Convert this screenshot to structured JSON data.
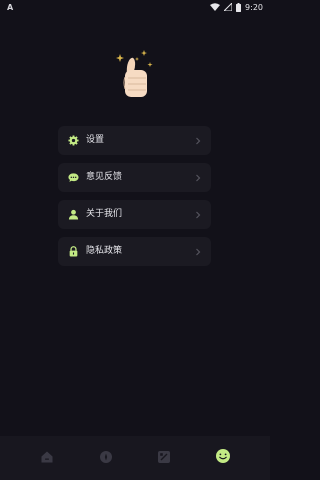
{
  "status_bar": {
    "left_label": "A",
    "time": "9:20"
  },
  "menu": {
    "items": [
      {
        "label": "设置",
        "icon": "gear-icon"
      },
      {
        "label": "意见反馈",
        "icon": "chat-icon"
      },
      {
        "label": "关于我们",
        "icon": "user-icon"
      },
      {
        "label": "隐私政策",
        "icon": "lock-icon"
      }
    ]
  },
  "bottom_nav": {
    "items": [
      {
        "icon": "home-icon"
      },
      {
        "icon": "compass-icon"
      },
      {
        "icon": "tiles-icon"
      },
      {
        "icon": "smile-icon",
        "active": true
      }
    ]
  },
  "colors": {
    "background": "#121119",
    "card": "#1b1a22",
    "accent": "#c3ea85",
    "text": "#e7e7ec",
    "nav_inactive": "#3a3944"
  }
}
